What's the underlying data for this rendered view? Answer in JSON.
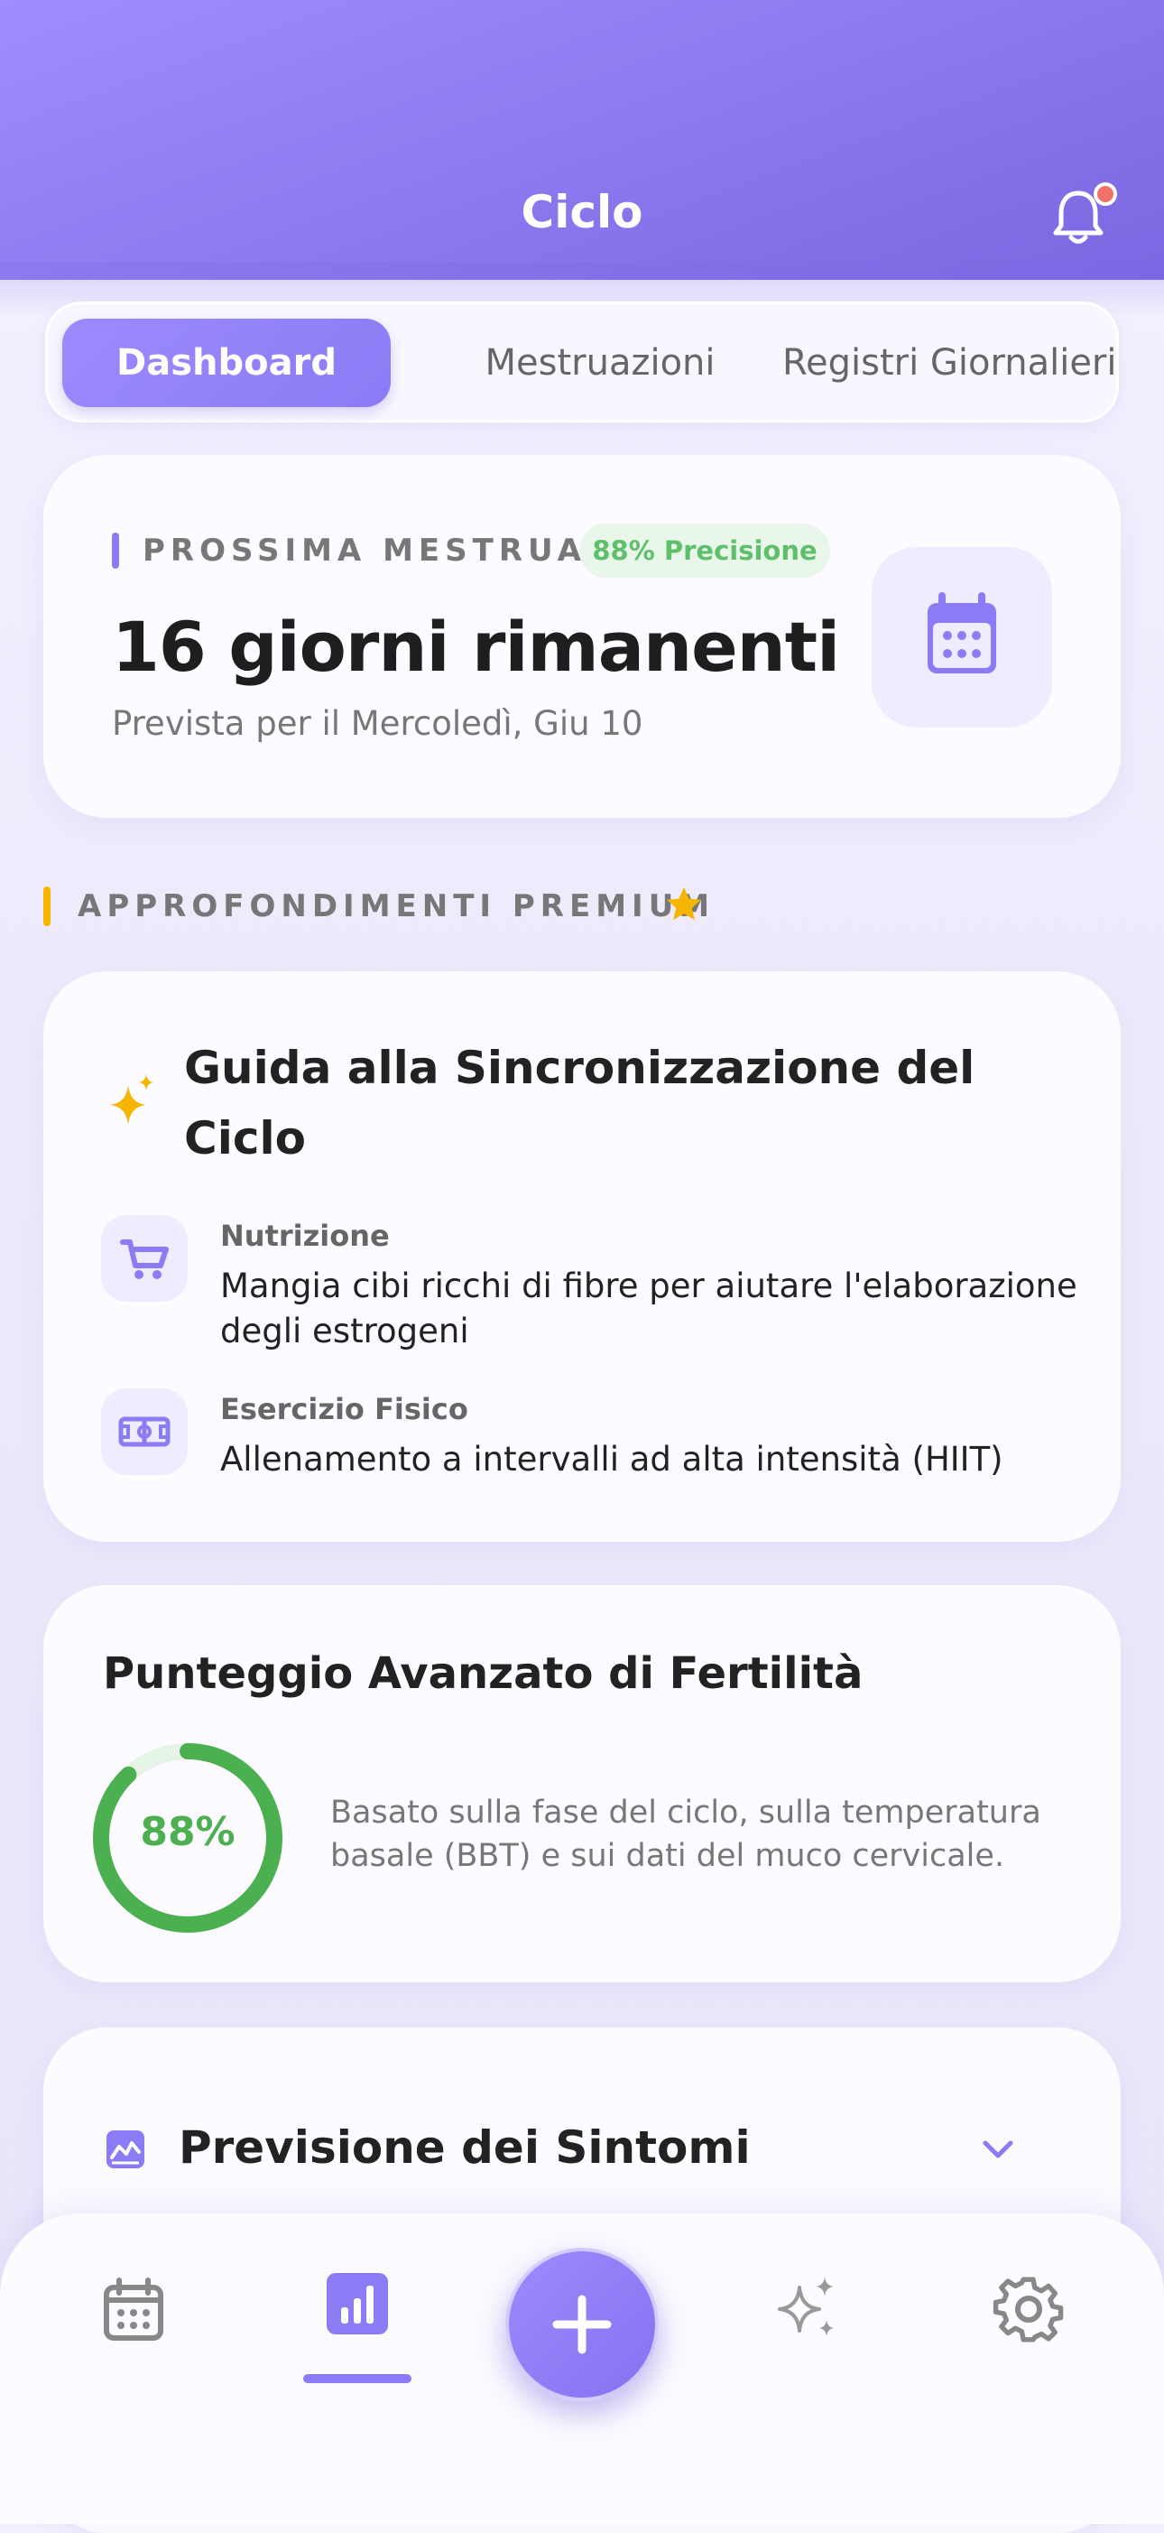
{
  "header": {
    "title": "Ciclo"
  },
  "tabs": [
    {
      "label": "Dashboard",
      "active": true
    },
    {
      "label": "Mestruazioni",
      "active": false
    },
    {
      "label": "Registri Giornalieri",
      "active": false
    }
  ],
  "next_period": {
    "label": "PROSSIMA MESTRUA…",
    "accuracy": "88% Precisione",
    "days_left": "16 giorni rimanenti",
    "expected": "Prevista per il Mercoledì, Giu 10"
  },
  "premium": {
    "section_label": "APPROFONDIMENTI PREMIUM",
    "guide_title": "Guida alla Sincronizzazione del Ciclo",
    "items": [
      {
        "label": "Nutrizione",
        "text": "Mangia cibi ricchi di fibre per aiutare l'elaborazione degli estrogeni",
        "icon": "cart-icon"
      },
      {
        "label": "Esercizio Fisico",
        "text": "Allenamento a intervalli ad alta intensità (HIIT)",
        "icon": "sports-field-icon"
      }
    ]
  },
  "fertility": {
    "title": "Punteggio Avanzato di Fertilità",
    "score_text": "88%",
    "score": 0.88,
    "description": "Basato sulla fase del ciclo, sulla temperatura basale (BBT) e sui dati del muco cervicale."
  },
  "symptoms": {
    "title": "Previsione dei Sintomi"
  },
  "colors": {
    "accent": "#8b7cf5",
    "success": "#4caf50",
    "premium_star": "#f5b500",
    "notification": "#f0706a"
  },
  "nav": [
    {
      "icon": "calendar-icon",
      "active": false
    },
    {
      "icon": "chart-icon",
      "active": true
    },
    {
      "icon": "plus-icon",
      "active": false
    },
    {
      "icon": "sparkles-icon",
      "active": false
    },
    {
      "icon": "gear-icon",
      "active": false
    }
  ]
}
